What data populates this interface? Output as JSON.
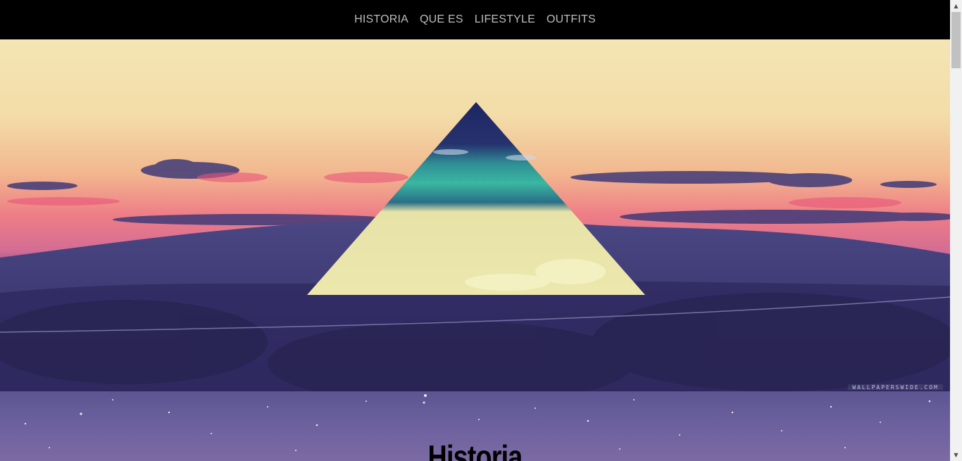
{
  "nav": {
    "items": [
      {
        "label": "HISTORIA"
      },
      {
        "label": "QUE ES"
      },
      {
        "label": "LIFESTYLE"
      },
      {
        "label": "OUTFITS"
      }
    ]
  },
  "hero": {
    "watermark": "WALLPAPERSWIDE.COM"
  },
  "section": {
    "title": "Historia"
  },
  "colors": {
    "nav_bg": "#000000",
    "nav_text": "#bdbdbd",
    "triangle_top": "#1f2a66",
    "triangle_band": "#2a9c92",
    "triangle_bottom": "#e9e6a8"
  }
}
